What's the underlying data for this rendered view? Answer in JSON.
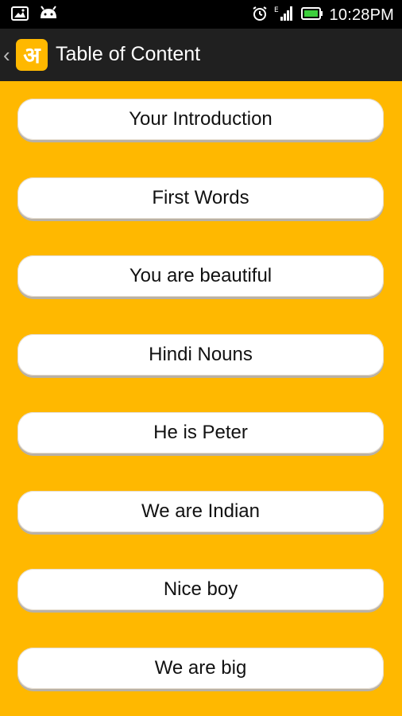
{
  "status_bar": {
    "time": "10:28PM",
    "icons": [
      "image-notification-icon",
      "android-notification-icon",
      "alarm-icon",
      "signal-icon",
      "battery-icon"
    ]
  },
  "app_bar": {
    "logo_text": "अ",
    "title": "Table of Content"
  },
  "items": [
    {
      "label": "Your Introduction"
    },
    {
      "label": "First Words"
    },
    {
      "label": "You are beautiful"
    },
    {
      "label": "Hindi Nouns"
    },
    {
      "label": "He is Peter"
    },
    {
      "label": "We are Indian"
    },
    {
      "label": "Nice boy"
    },
    {
      "label": "We are big"
    }
  ],
  "colors": {
    "background": "#FFB800",
    "app_bar": "#202020",
    "status_bar": "#000000",
    "item_bg": "#FFFFFF"
  }
}
